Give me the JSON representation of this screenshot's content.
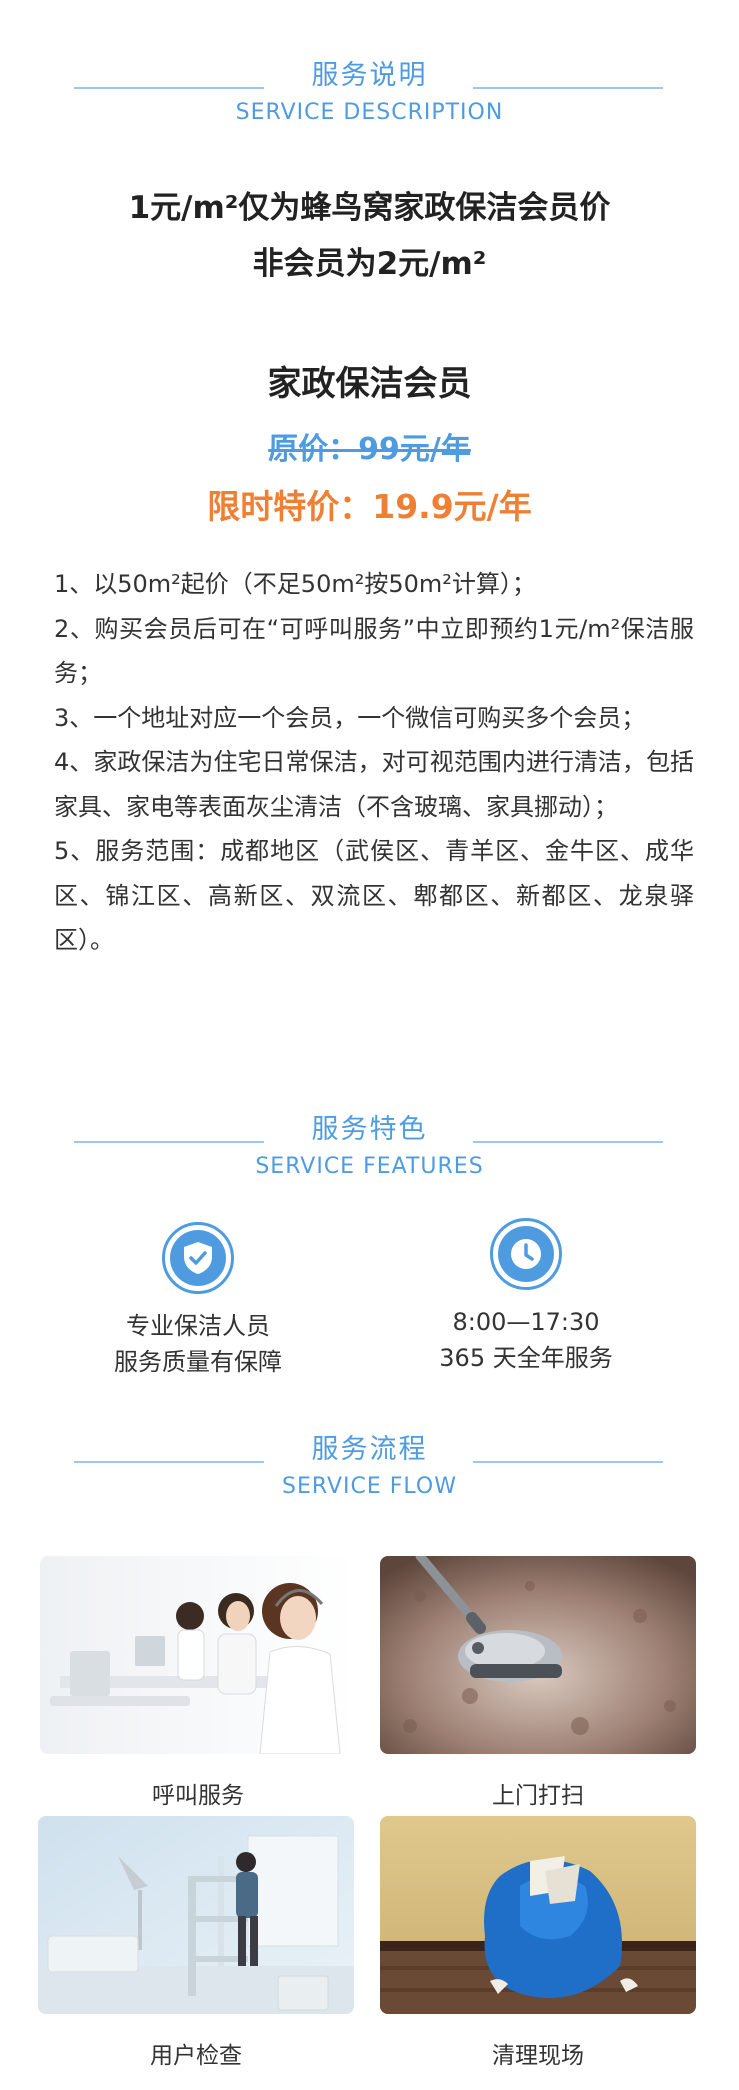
{
  "description": {
    "title_cn": "服务说明",
    "title_en": "SERVICE DESCRIPTION",
    "headline_line1": "1元/m²仅为蜂鸟窝家政保洁会员价",
    "headline_line2": "非会员为2元/m²"
  },
  "membership": {
    "title": "家政保洁会员",
    "original_price": "原价：99元/年",
    "special_price": "限时特价：19.9元/年"
  },
  "terms": [
    "1、以50m²起价（不足50m²按50m²计算）；",
    "2、购买会员后可在“可呼叫服务”中立即预约1元/m²保洁服务；",
    "3、一个地址对应一个会员，一个微信可购买多个会员；",
    "4、家政保洁为住宅日常保洁，对可视范围内进行清洁，包括家具、家电等表面灰尘清洁（不含玻璃、家具挪动）；",
    "5、服务范围：成都地区（武侯区、青羊区、金牛区、成华区、锦江区、高新区、双流区、郫都区、新都区、龙泉驿区）。"
  ],
  "features": {
    "title_cn": "服务特色",
    "title_en": "SERVICE FEATURES",
    "items": [
      {
        "icon": "shield-check-icon",
        "line1": "专业保洁人员",
        "line2": "服务质量有保障"
      },
      {
        "icon": "clock-icon",
        "line1": "8:00—17:30",
        "line2": "365 天全年服务"
      }
    ]
  },
  "flow": {
    "title_cn": "服务流程",
    "title_en": "SERVICE FLOW",
    "steps": [
      {
        "label": "呼叫服务",
        "photo": "call-center-photo"
      },
      {
        "label": "上门打扫",
        "photo": "vacuum-photo"
      },
      {
        "label": "用户检查",
        "photo": "room-check-photo"
      },
      {
        "label": "清理现场",
        "photo": "trash-bag-photo"
      }
    ]
  },
  "colors": {
    "accent_blue": "#4f9be0",
    "line_blue": "#9ec6ea",
    "orange": "#ef7f33",
    "text": "#333333"
  }
}
